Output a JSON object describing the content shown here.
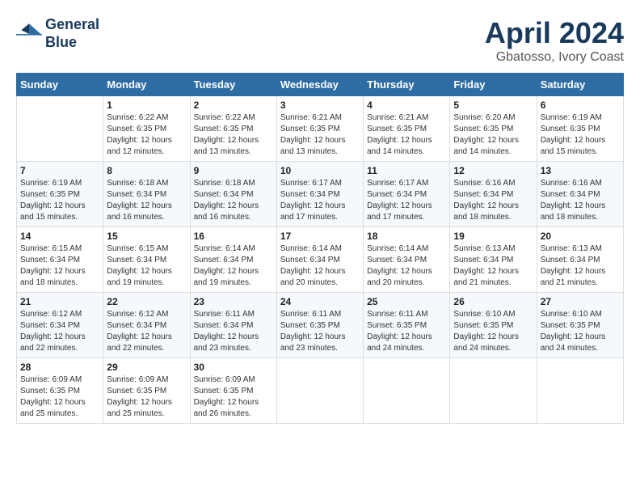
{
  "logo": {
    "line1": "General",
    "line2": "Blue"
  },
  "title": "April 2024",
  "location": "Gbatosso, Ivory Coast",
  "days_header": [
    "Sunday",
    "Monday",
    "Tuesday",
    "Wednesday",
    "Thursday",
    "Friday",
    "Saturday"
  ],
  "weeks": [
    [
      {
        "num": "",
        "info": ""
      },
      {
        "num": "1",
        "info": "Sunrise: 6:22 AM\nSunset: 6:35 PM\nDaylight: 12 hours\nand 12 minutes."
      },
      {
        "num": "2",
        "info": "Sunrise: 6:22 AM\nSunset: 6:35 PM\nDaylight: 12 hours\nand 13 minutes."
      },
      {
        "num": "3",
        "info": "Sunrise: 6:21 AM\nSunset: 6:35 PM\nDaylight: 12 hours\nand 13 minutes."
      },
      {
        "num": "4",
        "info": "Sunrise: 6:21 AM\nSunset: 6:35 PM\nDaylight: 12 hours\nand 14 minutes."
      },
      {
        "num": "5",
        "info": "Sunrise: 6:20 AM\nSunset: 6:35 PM\nDaylight: 12 hours\nand 14 minutes."
      },
      {
        "num": "6",
        "info": "Sunrise: 6:19 AM\nSunset: 6:35 PM\nDaylight: 12 hours\nand 15 minutes."
      }
    ],
    [
      {
        "num": "7",
        "info": "Sunrise: 6:19 AM\nSunset: 6:35 PM\nDaylight: 12 hours\nand 15 minutes."
      },
      {
        "num": "8",
        "info": "Sunrise: 6:18 AM\nSunset: 6:34 PM\nDaylight: 12 hours\nand 16 minutes."
      },
      {
        "num": "9",
        "info": "Sunrise: 6:18 AM\nSunset: 6:34 PM\nDaylight: 12 hours\nand 16 minutes."
      },
      {
        "num": "10",
        "info": "Sunrise: 6:17 AM\nSunset: 6:34 PM\nDaylight: 12 hours\nand 17 minutes."
      },
      {
        "num": "11",
        "info": "Sunrise: 6:17 AM\nSunset: 6:34 PM\nDaylight: 12 hours\nand 17 minutes."
      },
      {
        "num": "12",
        "info": "Sunrise: 6:16 AM\nSunset: 6:34 PM\nDaylight: 12 hours\nand 18 minutes."
      },
      {
        "num": "13",
        "info": "Sunrise: 6:16 AM\nSunset: 6:34 PM\nDaylight: 12 hours\nand 18 minutes."
      }
    ],
    [
      {
        "num": "14",
        "info": "Sunrise: 6:15 AM\nSunset: 6:34 PM\nDaylight: 12 hours\nand 18 minutes."
      },
      {
        "num": "15",
        "info": "Sunrise: 6:15 AM\nSunset: 6:34 PM\nDaylight: 12 hours\nand 19 minutes."
      },
      {
        "num": "16",
        "info": "Sunrise: 6:14 AM\nSunset: 6:34 PM\nDaylight: 12 hours\nand 19 minutes."
      },
      {
        "num": "17",
        "info": "Sunrise: 6:14 AM\nSunset: 6:34 PM\nDaylight: 12 hours\nand 20 minutes."
      },
      {
        "num": "18",
        "info": "Sunrise: 6:14 AM\nSunset: 6:34 PM\nDaylight: 12 hours\nand 20 minutes."
      },
      {
        "num": "19",
        "info": "Sunrise: 6:13 AM\nSunset: 6:34 PM\nDaylight: 12 hours\nand 21 minutes."
      },
      {
        "num": "20",
        "info": "Sunrise: 6:13 AM\nSunset: 6:34 PM\nDaylight: 12 hours\nand 21 minutes."
      }
    ],
    [
      {
        "num": "21",
        "info": "Sunrise: 6:12 AM\nSunset: 6:34 PM\nDaylight: 12 hours\nand 22 minutes."
      },
      {
        "num": "22",
        "info": "Sunrise: 6:12 AM\nSunset: 6:34 PM\nDaylight: 12 hours\nand 22 minutes."
      },
      {
        "num": "23",
        "info": "Sunrise: 6:11 AM\nSunset: 6:34 PM\nDaylight: 12 hours\nand 23 minutes."
      },
      {
        "num": "24",
        "info": "Sunrise: 6:11 AM\nSunset: 6:35 PM\nDaylight: 12 hours\nand 23 minutes."
      },
      {
        "num": "25",
        "info": "Sunrise: 6:11 AM\nSunset: 6:35 PM\nDaylight: 12 hours\nand 24 minutes."
      },
      {
        "num": "26",
        "info": "Sunrise: 6:10 AM\nSunset: 6:35 PM\nDaylight: 12 hours\nand 24 minutes."
      },
      {
        "num": "27",
        "info": "Sunrise: 6:10 AM\nSunset: 6:35 PM\nDaylight: 12 hours\nand 24 minutes."
      }
    ],
    [
      {
        "num": "28",
        "info": "Sunrise: 6:09 AM\nSunset: 6:35 PM\nDaylight: 12 hours\nand 25 minutes."
      },
      {
        "num": "29",
        "info": "Sunrise: 6:09 AM\nSunset: 6:35 PM\nDaylight: 12 hours\nand 25 minutes."
      },
      {
        "num": "30",
        "info": "Sunrise: 6:09 AM\nSunset: 6:35 PM\nDaylight: 12 hours\nand 26 minutes."
      },
      {
        "num": "",
        "info": ""
      },
      {
        "num": "",
        "info": ""
      },
      {
        "num": "",
        "info": ""
      },
      {
        "num": "",
        "info": ""
      }
    ]
  ]
}
